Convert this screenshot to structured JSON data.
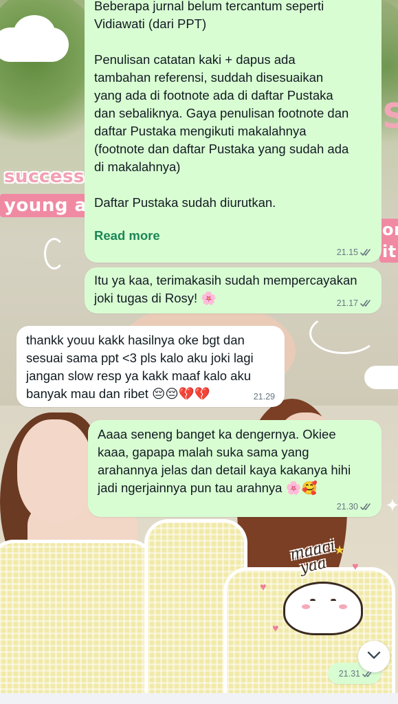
{
  "messages": [
    {
      "direction": "outgoing",
      "text": "Beberapa jurnal belum tercantum seperti\nVidiawati (dari PPT)\n\nPenulisan catatan kaki + dapus ada\ntambahan referensi, suddah disesuaikan\nyang ada di footnote ada di daftar Pustaka\ndan sebaliknya. Gaya penulisan footnote dan\ndaftar Pustaka mengikuti makalahnya\n(footnote dan daftar Pustaka yang sudah ada\ndi makalahnya)\n\nDaftar Pustaka sudah diurutkan.",
      "read_more": "Read more",
      "time": "21.15",
      "status": "read"
    },
    {
      "direction": "outgoing",
      "text": "Itu ya kaa, terimakasih sudah mempercayakan\njoki tugas di Rosy! 🌸",
      "time": "21.17",
      "status": "read"
    },
    {
      "direction": "incoming",
      "text": "thankk youu kakk hasilnya oke bgt dan\nsesuai sama ppt <3 pls kalo aku joki lagi\njangan slow resp ya kakk maaf kalo aku\nbanyak mau dan ribet 😔😔💔💔",
      "time": "21.29"
    },
    {
      "direction": "outgoing",
      "text": "Aaaa seneng banget ka dengernya. Okiee\nkaaa, gapapa malah suka sama yang\narahannya jelas dan detail kaya kakanya hihi\njadi ngerjainnya pun tau arahnya 🌸🥰",
      "time": "21.30",
      "status": "read"
    },
    {
      "direction": "outgoing",
      "type": "sticker",
      "time": "21.31",
      "status": "read"
    }
  ],
  "wallpaper": {
    "sticker_text_1": "success at",
    "sticker_text_2": "young age",
    "sticker_text_3": "or",
    "sticker_text_4": "it",
    "sticker_text_5": "S",
    "sticker_caption_1": "maaci",
    "sticker_caption_2": "yaa"
  },
  "icons": {
    "scroll_down": "chevron-down-icon",
    "read_receipt": "double-check-icon"
  },
  "colors": {
    "outgoing_bubble": "#d9fdd3",
    "incoming_bubble": "#ffffff",
    "read_more": "#1b8755",
    "meta": "#667781"
  }
}
